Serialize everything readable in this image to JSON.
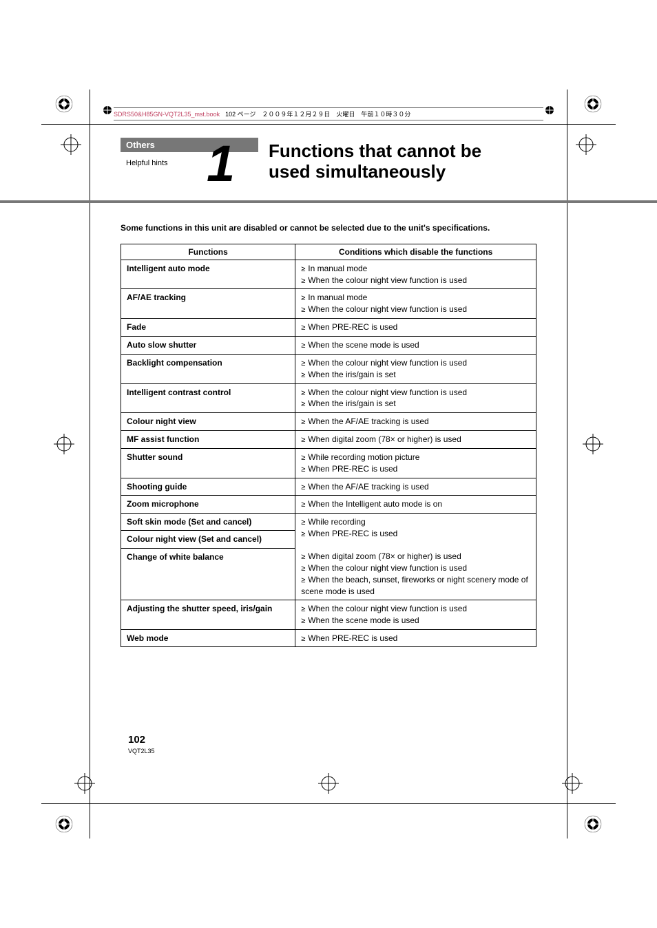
{
  "header": {
    "filename": "SDRS50&H85GN-VQT2L35_mst.book",
    "rest": "102 ページ　２００９年１２月２９日　火曜日　午前１０時３０分"
  },
  "section": "Others",
  "subtitle": "Helpful hints",
  "chapter_number": "1",
  "title_line1": "Functions that cannot be",
  "title_line2": "used simultaneously",
  "intro": "Some functions in this unit are disabled or cannot be selected due to the unit's specifications.",
  "table": {
    "header_func": "Functions",
    "header_cond": "Conditions which disable the functions",
    "rows": [
      {
        "func": "Intelligent auto mode",
        "cond": [
          "In manual mode",
          "When the colour night view function is used"
        ]
      },
      {
        "func": "AF/AE tracking",
        "cond": [
          "In manual mode",
          "When the colour night view function is used"
        ]
      },
      {
        "func": "Fade",
        "cond": [
          "When PRE-REC is used"
        ]
      },
      {
        "func": "Auto slow shutter",
        "cond": [
          "When the scene mode is used"
        ]
      },
      {
        "func": "Backlight compensation",
        "cond": [
          "When the colour night view function is used",
          "When the iris/gain is set"
        ]
      },
      {
        "func": "Intelligent contrast control",
        "cond": [
          "When the colour night view function is used",
          "When the iris/gain is set"
        ]
      },
      {
        "func": "Colour night view",
        "cond": [
          "When the AF/AE tracking is used"
        ]
      },
      {
        "func": "MF assist function",
        "cond": [
          "When digital zoom (78× or higher) is used"
        ]
      },
      {
        "func": "Shutter sound",
        "cond": [
          "While recording motion picture",
          "When PRE-REC is used"
        ]
      },
      {
        "func": "Shooting guide",
        "cond": [
          "When the AF/AE tracking is used"
        ]
      },
      {
        "func": "Zoom microphone",
        "cond": [
          "When the Intelligent auto mode is on"
        ]
      },
      {
        "func": "Soft skin mode (Set and cancel)",
        "cond": [
          "While recording",
          "When PRE-REC is used"
        ],
        "merge_next": true
      },
      {
        "func": "Colour night view (Set and cancel)",
        "cond": [],
        "merged": true
      },
      {
        "func": "Change of white balance",
        "cond": [
          "When digital zoom (78× or higher) is used",
          "When the colour night view function is used",
          "When the beach, sunset, fireworks or night scenery mode of scene mode is used"
        ]
      },
      {
        "func": "Adjusting the shutter speed, iris/gain",
        "cond": [
          "When the colour night view function is used",
          "When the scene mode is used"
        ]
      },
      {
        "func": "Web mode",
        "cond": [
          "When PRE-REC is used"
        ]
      }
    ]
  },
  "page_number": "102",
  "doc_code": "VQT2L35"
}
